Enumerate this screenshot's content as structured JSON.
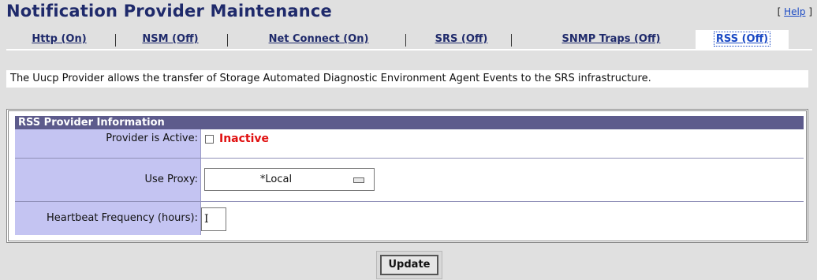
{
  "page": {
    "title": "Notification Provider Maintenance",
    "help": {
      "open": "[ ",
      "label": "Help",
      "close": " ]"
    }
  },
  "tabs": [
    {
      "label": "Http (On)",
      "active": false
    },
    {
      "label": "NSM (Off)",
      "active": false
    },
    {
      "label": "Net Connect (On)",
      "active": false
    },
    {
      "label": "SRS (Off)",
      "active": false
    },
    {
      "label": "SNMP Traps (Off)",
      "active": false
    },
    {
      "label": "RSS (Off)",
      "active": true
    }
  ],
  "description": "The Uucp Provider allows the transfer of Storage Automated Diagnostic Environment Agent Events to the SRS infrastructure.",
  "panel": {
    "header": "RSS Provider Information",
    "active_row": {
      "label": "Provider is Active:",
      "checked": false,
      "status": "Inactive"
    },
    "proxy_row": {
      "label": "Use Proxy:",
      "value": "*Local"
    },
    "heartbeat_row": {
      "label": "Heartbeat Frequency (hours):",
      "value": ""
    }
  },
  "buttons": {
    "update": "Update"
  },
  "colors": {
    "title": "#1f2a6b",
    "panel_header": "#5d5b8c",
    "label_background": "#c4c4f2",
    "inactive_status": "#e01010"
  }
}
